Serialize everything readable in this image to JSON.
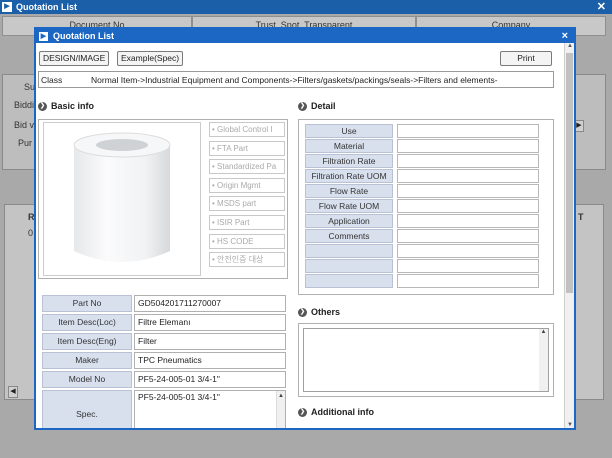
{
  "background": {
    "title": "Quotation List",
    "headers": [
      "Document No",
      "Trust, Spot, Transparent",
      "Company"
    ],
    "labels": [
      "Su",
      "Biddi",
      "Bid v",
      "Pur",
      "R",
      "0",
      "T"
    ]
  },
  "modal": {
    "title": "Quotation List",
    "close": "×",
    "toolbar": {
      "design_label": "DESIGN/IMAGE",
      "example_label": "Example(Spec)",
      "print_label": "Print"
    },
    "class_label": "Class",
    "class_path": "Normal Item->Industrial Equipment and Components->Filters/gaskets/packings/seals->Filters and elements-",
    "basic_info_title": "Basic info",
    "detail_title": "Detail",
    "others_title": "Others",
    "additional_title": "Additional info",
    "flags": [
      "Global Control I",
      "FTA Part",
      "Standardized Pa",
      "Origin Mgmt",
      "MSDS part",
      "ISIR Part",
      "HS CODE",
      "안전인증 대상"
    ],
    "fields": [
      {
        "label": "Part No",
        "value": "GD504201711270007"
      },
      {
        "label": "Item Desc(Loc)",
        "value": "Filtre Elemanı"
      },
      {
        "label": "Item Desc(Eng)",
        "value": "Filter"
      },
      {
        "label": "Maker",
        "value": "TPC Pneumatics"
      },
      {
        "label": "Model No",
        "value": "PF5-24-005-01  3/4-1\""
      }
    ],
    "spec": {
      "label": "Spec.",
      "value": "PF5-24-005-01  3/4-1\""
    },
    "detail_rows": [
      "Use",
      "Material",
      "Filtration Rate",
      "Filtration Rate UOM",
      "Flow Rate",
      "Flow Rate UOM",
      "Application",
      "Comments",
      "",
      "",
      "",
      ""
    ]
  }
}
